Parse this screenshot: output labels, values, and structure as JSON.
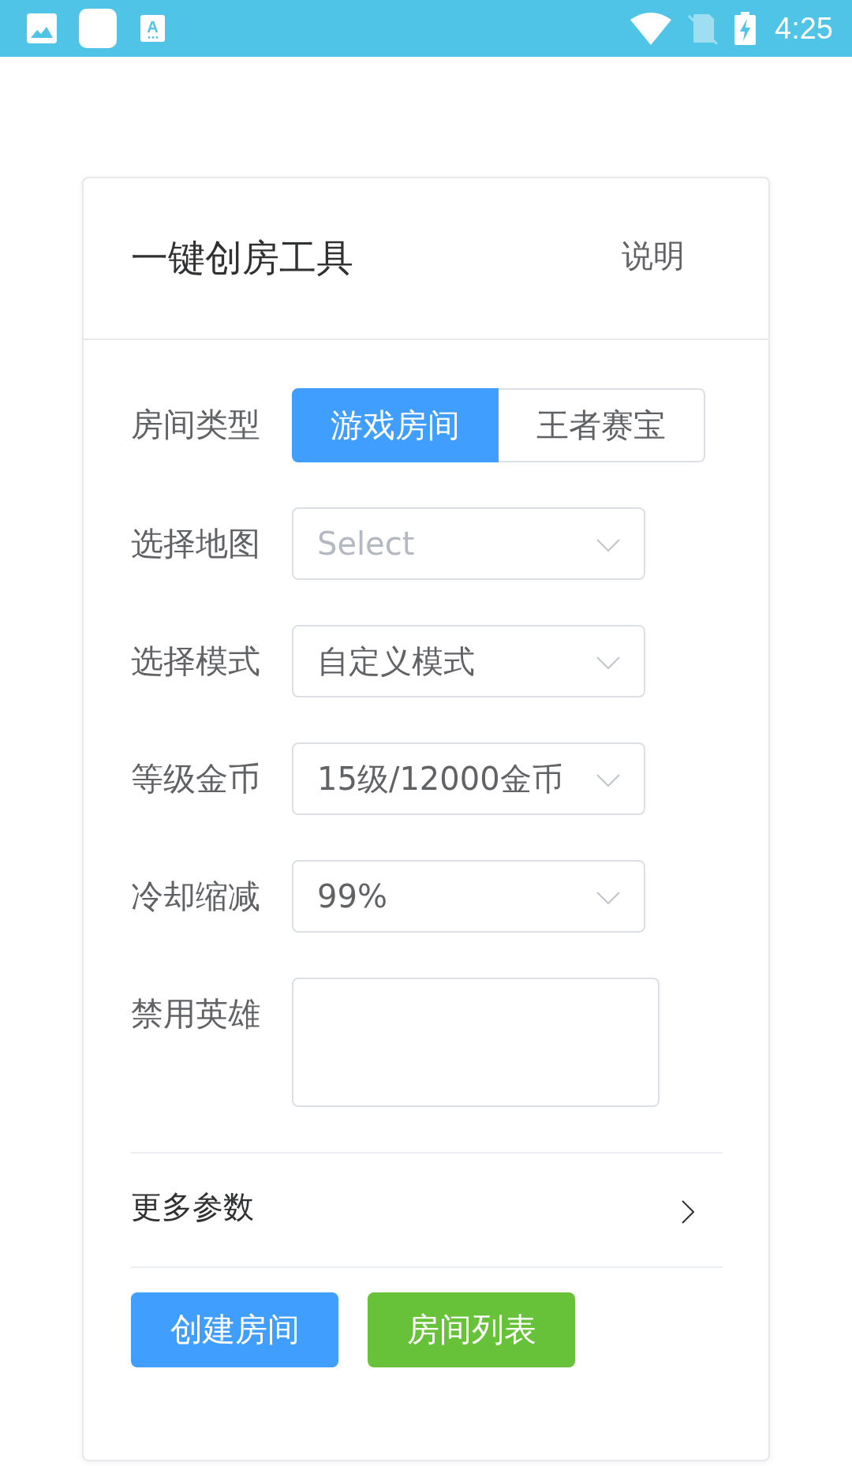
{
  "status_bar": {
    "input_icon_letter": "A",
    "time": "4:25"
  },
  "card": {
    "title": "一键创房工具",
    "help_link": "说明"
  },
  "form": {
    "fields": [
      {
        "kind": "segmented",
        "label": "房间类型",
        "options": [
          {
            "label": "游戏房间",
            "selected": true
          },
          {
            "label": "王者赛宝",
            "selected": false
          }
        ]
      },
      {
        "kind": "select",
        "label": "选择地图",
        "placeholder": "Select"
      },
      {
        "kind": "select",
        "label": "选择模式",
        "value": "自定义模式"
      },
      {
        "kind": "select",
        "label": "等级金币",
        "value": "15级/12000金币"
      },
      {
        "kind": "select",
        "label": "冷却缩减",
        "value": "99%"
      },
      {
        "kind": "textarea",
        "label": "禁用英雄"
      }
    ]
  },
  "more_params": {
    "label": "更多参数"
  },
  "buttons": [
    {
      "kind": "primary",
      "label": "创建房间"
    },
    {
      "kind": "success",
      "label": "房间列表"
    }
  ]
}
